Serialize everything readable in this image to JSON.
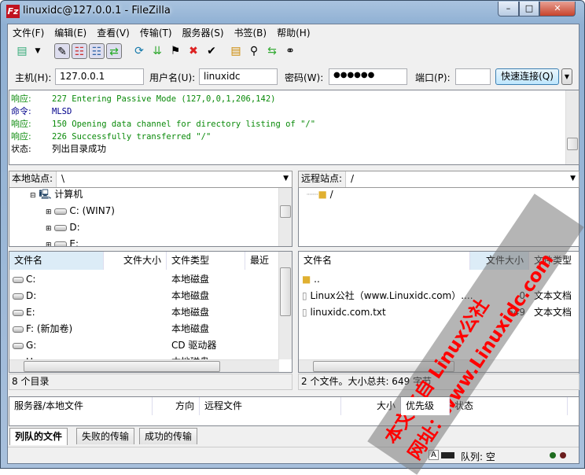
{
  "window": {
    "title": "linuxidc@127.0.0.1 - FileZilla",
    "app_icon": "Fz",
    "min": "–",
    "max": "□",
    "close": "✕"
  },
  "menu": [
    "文件(F)",
    "编辑(E)",
    "查看(V)",
    "传输(T)",
    "服务器(S)",
    "书签(B)",
    "帮助(H)"
  ],
  "quickconnect": {
    "host_label": "主机(H):",
    "host": "127.0.0.1",
    "user_label": "用户名(U):",
    "user": "linuxidc",
    "pass_label": "密码(W):",
    "pass": "●●●●●●",
    "port_label": "端口(P):",
    "port": "",
    "button": "快速连接(Q)"
  },
  "log": [
    {
      "k": "响应:",
      "t": "227 Entering Passive Mode (127,0,0,1,206,142)",
      "c": "g"
    },
    {
      "k": "命令:",
      "t": "MLSD",
      "c": "b"
    },
    {
      "k": "响应:",
      "t": "150 Opening data channel for directory listing of \"/\"",
      "c": "g"
    },
    {
      "k": "响应:",
      "t": "226 Successfully transferred \"/\"",
      "c": "g"
    },
    {
      "k": "状态:",
      "t": "列出目录成功",
      "c": ""
    }
  ],
  "local": {
    "site_label": "本地站点:",
    "path": "\\",
    "tree": [
      "计算机",
      "C: (WIN7)",
      "D:",
      "E:"
    ],
    "columns": [
      "文件名",
      "文件大小",
      "文件类型",
      "最近修"
    ],
    "files": [
      {
        "name": "C:",
        "type": "本地磁盘"
      },
      {
        "name": "D:",
        "type": "本地磁盘"
      },
      {
        "name": "E:",
        "type": "本地磁盘"
      },
      {
        "name": "F: (新加卷)",
        "type": "本地磁盘"
      },
      {
        "name": "G:",
        "type": "CD 驱动器"
      },
      {
        "name": "H:",
        "type": "本地磁盘"
      }
    ],
    "status": "8 个目录"
  },
  "remote": {
    "site_label": "远程站点:",
    "path": "/",
    "tree": [
      "/"
    ],
    "columns": [
      "文件名",
      "文件大小",
      "文件类型"
    ],
    "files": [
      {
        "name": "..",
        "size": "",
        "type": ""
      },
      {
        "name": "Linux公社（www.Linuxidc.com）....",
        "size": "0",
        "type": "文本文档"
      },
      {
        "name": "linuxidc.com.txt",
        "size": "649",
        "type": "文本文档"
      }
    ],
    "status": "2 个文件。大小总共: 649 字节"
  },
  "queue": {
    "columns": [
      "服务器/本地文件",
      "方向",
      "远程文件",
      "大小",
      "优先级",
      "状态"
    ],
    "tabs": [
      "列队的文件",
      "失败的传输",
      "成功的传输"
    ]
  },
  "statusbar": {
    "queue": "队列: 空"
  },
  "watermark": {
    "line1": "本文来自 Linux公社",
    "line2": "网址：www.Linuxidc.com"
  }
}
